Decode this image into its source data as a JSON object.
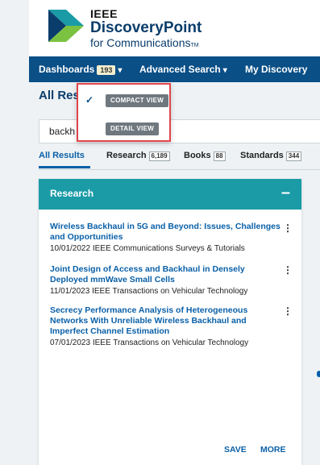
{
  "brand": {
    "org": "IEEE",
    "name": "DiscoveryPoint",
    "tagline": "for Communications",
    "tm": "TM"
  },
  "nav": {
    "dashboards": "Dashboards",
    "dashboards_count": "193",
    "advanced_search": "Advanced Search",
    "my_discovery": "My Discovery"
  },
  "page_title": "All Res",
  "search": {
    "value": "backh"
  },
  "tabs": [
    {
      "label": "All Results",
      "count": ""
    },
    {
      "label": "Research",
      "count": "6,189"
    },
    {
      "label": "Books",
      "count": "88"
    },
    {
      "label": "Standards",
      "count": "344"
    }
  ],
  "view_menu": {
    "compact": "COMPACT VIEW",
    "detail": "DETAIL VIEW",
    "check": "✓"
  },
  "card": {
    "title": "Research",
    "collapse": "–",
    "results": [
      {
        "title": "Wireless Backhaul in 5G and Beyond: Issues, Challenges and Opportunities",
        "meta": "10/01/2022   IEEE Communications Surveys & Tutorials"
      },
      {
        "title": "Joint Design of Access and Backhaul in Densely Deployed mmWave Small Cells",
        "meta": "11/01/2023   IEEE Transactions on Vehicular Technology"
      },
      {
        "title": "Secrecy Performance Analysis of Heterogeneous Networks With Unreliable Wireless Backhaul and Imperfect Channel Estimation",
        "meta": "07/01/2023   IEEE Transactions on Vehicular Technology"
      }
    ],
    "save": "SAVE",
    "more": "MORE"
  },
  "colors": {
    "nav": "#0a4f86",
    "card_head": "#1a9ba6",
    "link": "#0a60a8",
    "highlight": "#e0454b"
  },
  "icons": {
    "kebab": "⋮",
    "caret": "▾"
  }
}
